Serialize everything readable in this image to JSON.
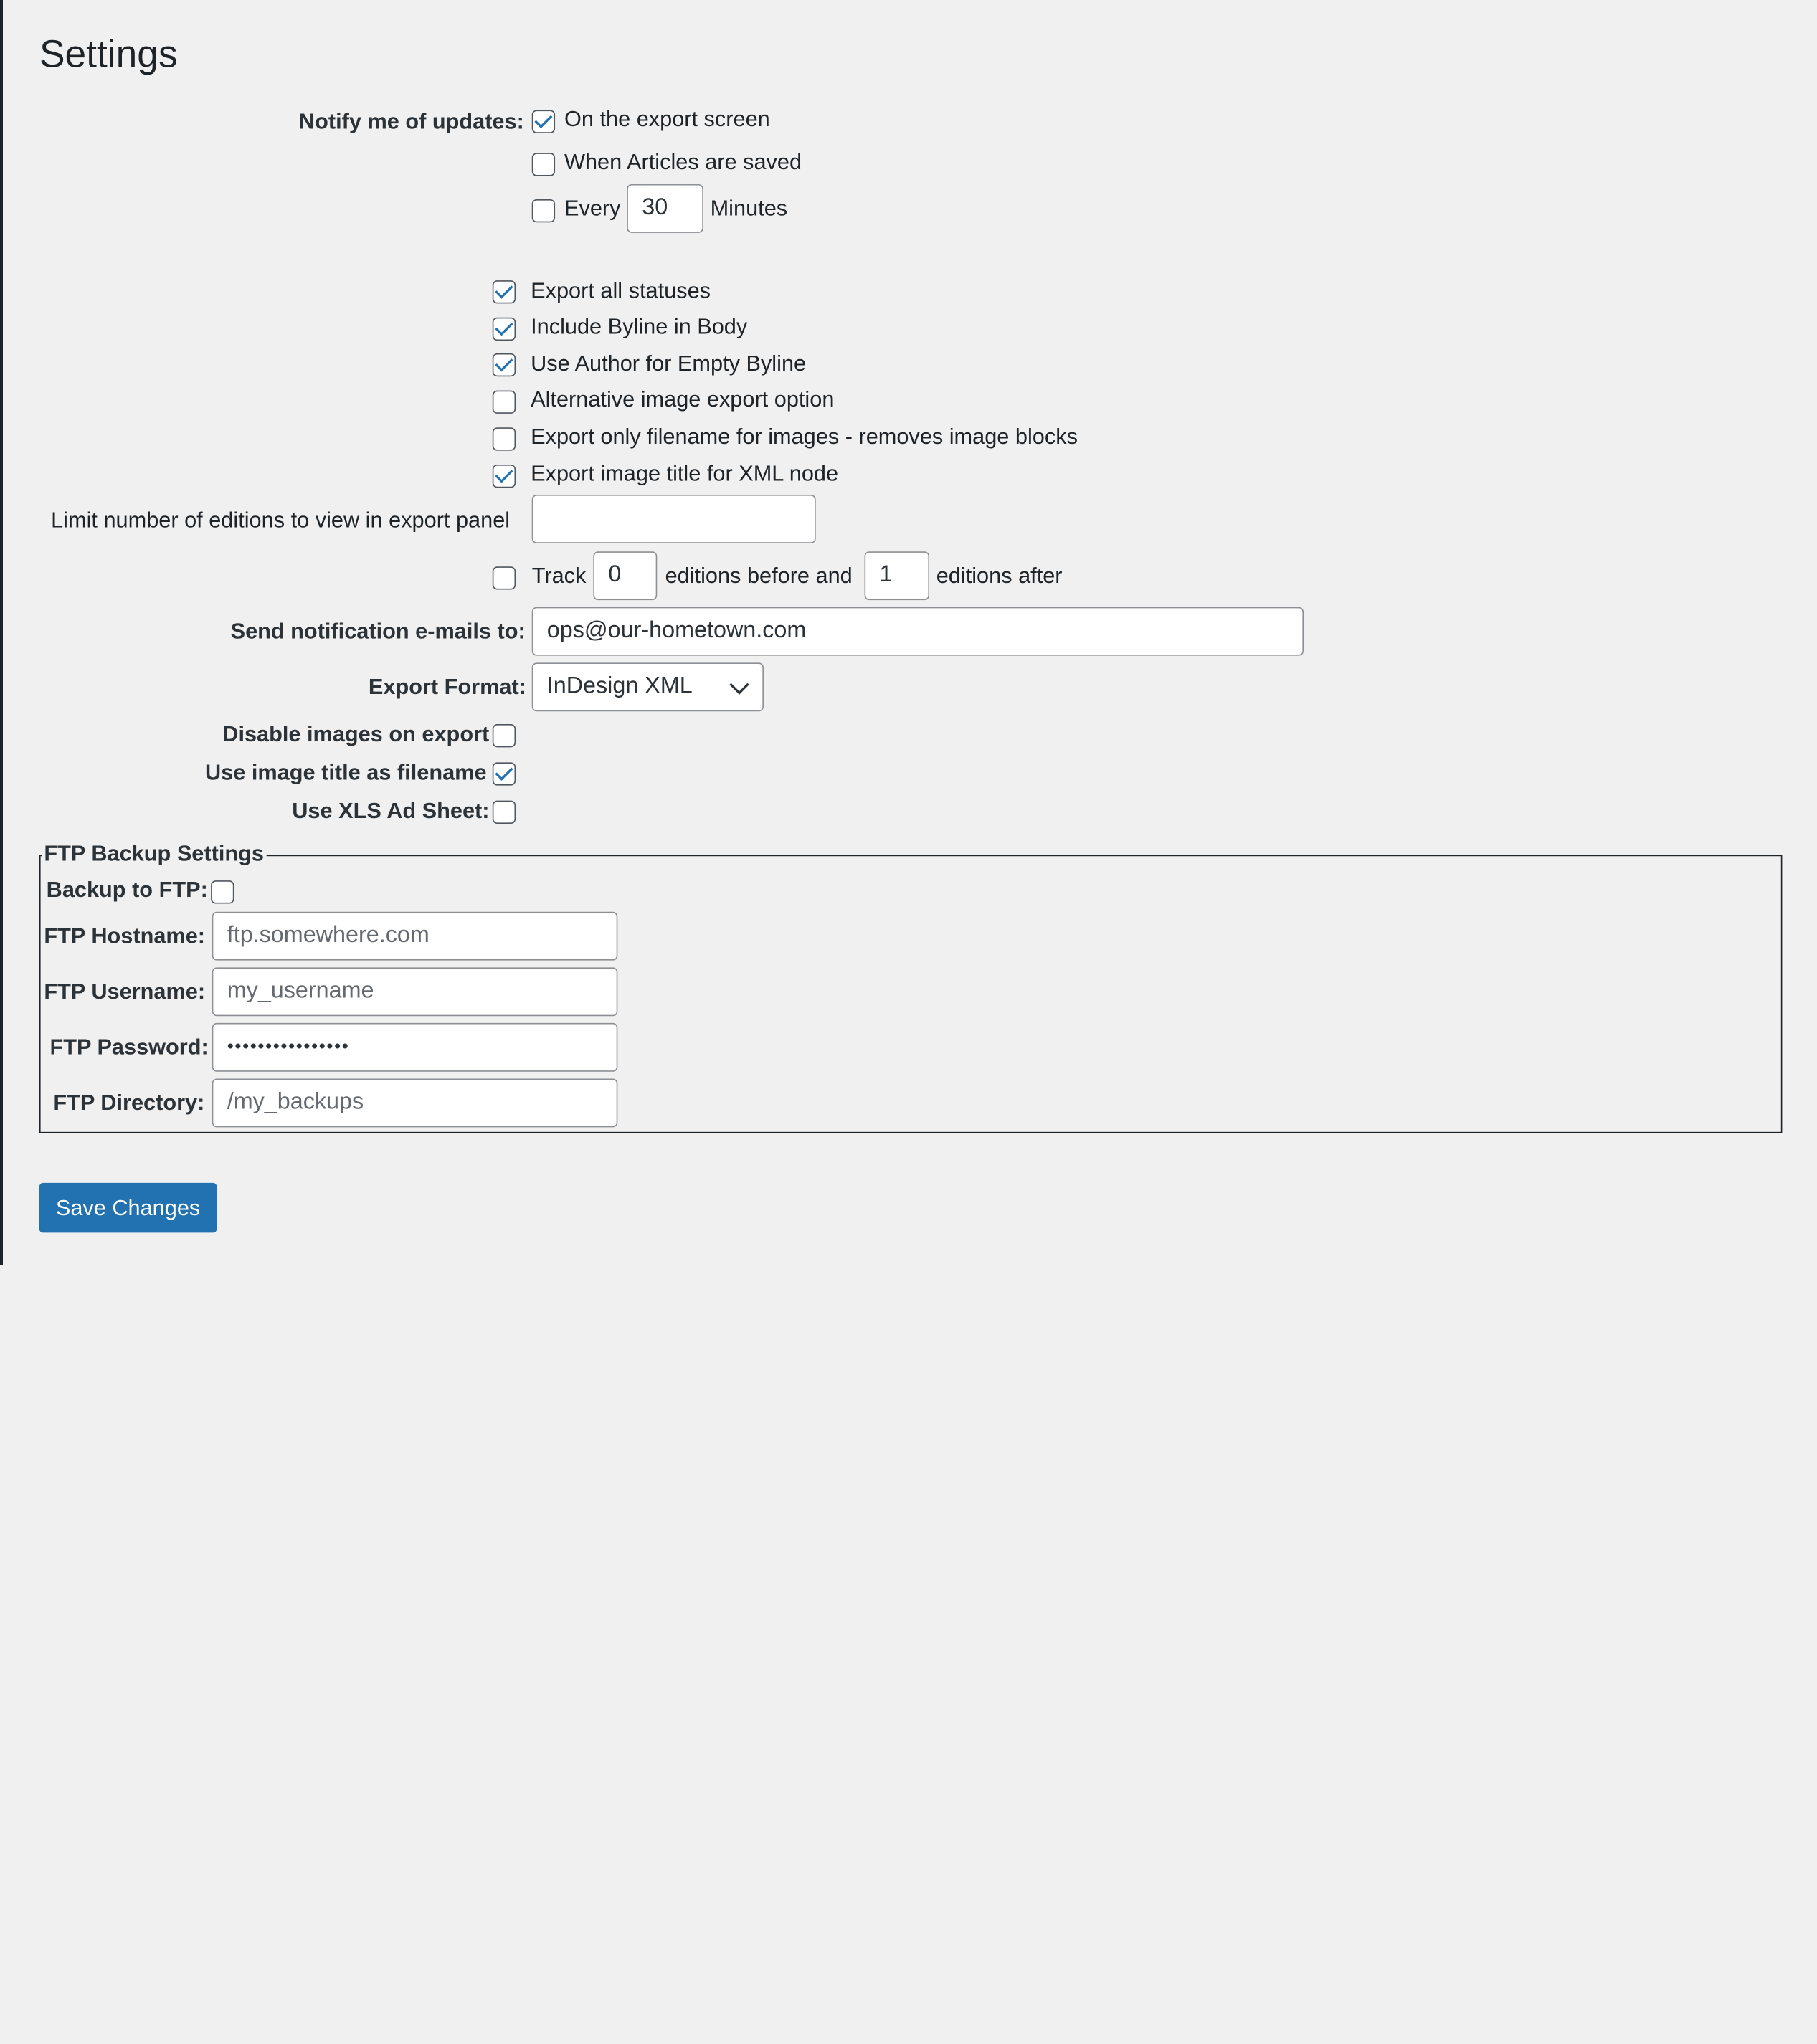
{
  "page": {
    "title": "Settings"
  },
  "notify": {
    "label": "Notify me of updates:",
    "options": [
      {
        "label": "On the export screen",
        "checked": true
      },
      {
        "label": "When Articles are saved",
        "checked": false
      },
      {
        "label": "Every",
        "checked": false
      }
    ],
    "every_value": "30",
    "minutes_label": "Minutes"
  },
  "export_options": [
    {
      "label": "Export all statuses",
      "checked": true
    },
    {
      "label": "Include Byline in Body",
      "checked": true
    },
    {
      "label": "Use Author for Empty Byline",
      "checked": true
    },
    {
      "label": "Alternative image export option",
      "checked": false
    },
    {
      "label": "Export only filename for images - removes image blocks",
      "checked": false
    },
    {
      "label": "Export image title for XML node",
      "checked": true
    }
  ],
  "limit_editions": {
    "label": "Limit number of editions to view in export panel",
    "value": ""
  },
  "track": {
    "checked": false,
    "label": "Track",
    "before_value": "0",
    "before_label": "editions before and",
    "after_value": "1",
    "after_label": "editions after"
  },
  "notification_email": {
    "label": "Send notification e-mails to:",
    "value": "ops@our-hometown.com"
  },
  "export_format": {
    "label": "Export Format:",
    "selected": "InDesign XML"
  },
  "disable_images": {
    "label": "Disable images on export",
    "checked": false
  },
  "image_title_filename": {
    "label": "Use image title as filename",
    "checked": true
  },
  "xls_ad_sheet": {
    "label": "Use XLS Ad Sheet:",
    "checked": false
  },
  "ftp": {
    "legend": "FTP Backup Settings",
    "backup_label": "Backup to FTP:",
    "backup_checked": false,
    "hostname_label": "FTP Hostname:",
    "hostname_placeholder": "ftp.somewhere.com",
    "username_label": "FTP Username:",
    "username_placeholder": "my_username",
    "password_label": "FTP Password:",
    "password_value": "••••••••••••••••",
    "directory_label": "FTP Directory:",
    "directory_placeholder": "/my_backups"
  },
  "save_button": {
    "label": "Save Changes"
  },
  "colors": {
    "accent": "#2271b1",
    "background": "#f0f0f1",
    "text": "#1d2327"
  }
}
